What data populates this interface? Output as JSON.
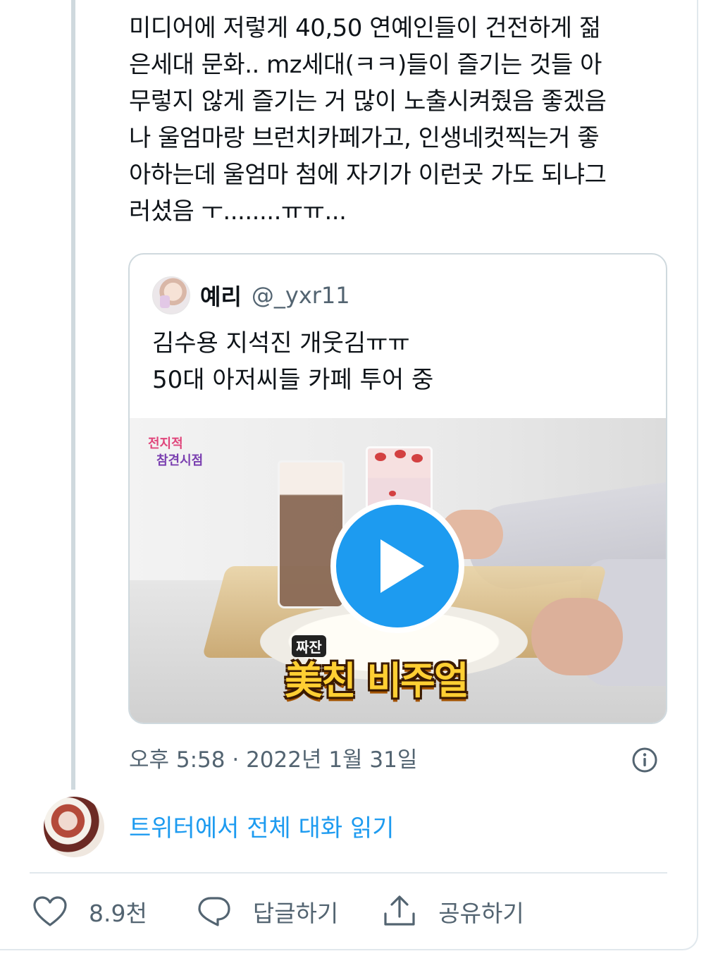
{
  "tweet": {
    "lines": [
      "미디어에 저렇게 40,50 연예인들이 건전하게 젊",
      "은세대 문화.. mz세대(ㅋㅋ)들이 즐기는 것들 아",
      "무렇지 않게 즐기는 거 많이 노출시켜줬음 좋겠음",
      "나 울엄마랑 브런치카페가고, 인생네컷찍는거 좋",
      "아하는데 울엄마 첨에 자기가 이런곳 가도 되냐그",
      "러셨음 ㅜ........ㅠㅠ..."
    ],
    "timestamp": "오후 5:58 · 2022년 1월 31일"
  },
  "quote": {
    "name": "예리",
    "handle": "@_yxr11",
    "lines": [
      "김수용 지석진 개웃김ㅠㅠ",
      "50대 아저씨들 카페 투어 중"
    ],
    "video": {
      "logo_text_1": "전지적",
      "logo_text_2": "참견시점",
      "caption_small": "짜잔",
      "caption_main": "美친 비주얼"
    }
  },
  "reply": {
    "read_more": "트위터에서 전체 대화 읽기"
  },
  "actions": {
    "like_count": "8.9천",
    "reply_label": "답글하기",
    "share_label": "공유하기"
  },
  "colors": {
    "accent": "#1d9bf0",
    "secondary_text": "#536471",
    "border": "#cfd9de"
  },
  "icons": [
    "heart-icon",
    "reply-icon",
    "share-icon",
    "info-icon",
    "play-icon"
  ]
}
